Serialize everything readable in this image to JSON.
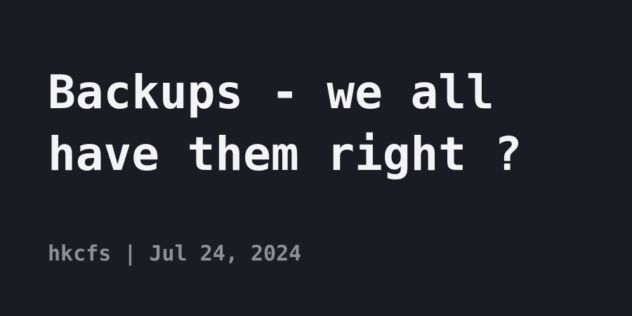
{
  "title": "Backups - we all have them right ?",
  "author": "hkcfs",
  "separator": "|",
  "date": "Jul 24, 2024",
  "colors": {
    "background": "#1b1b24",
    "title_text": "#f4f4f6",
    "meta_text": "#8f8f96"
  }
}
